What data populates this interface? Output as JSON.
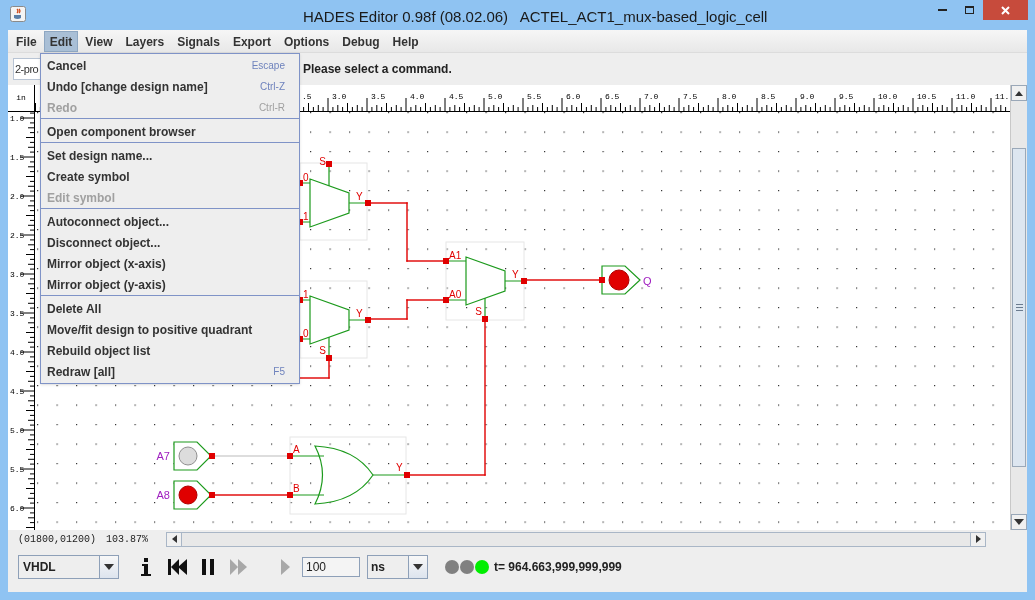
{
  "window": {
    "title": "HADES Editor 0.98f (08.02.06)   ACTEL_ACT1_mux-based_logic_cell"
  },
  "menu_bar": [
    {
      "label": "File",
      "selected": false
    },
    {
      "label": "Edit",
      "selected": true
    },
    {
      "label": "View",
      "selected": false
    },
    {
      "label": "Layers",
      "selected": false
    },
    {
      "label": "Signals",
      "selected": false
    },
    {
      "label": "Export",
      "selected": false
    },
    {
      "label": "Options",
      "selected": false
    },
    {
      "label": "Debug",
      "selected": false
    },
    {
      "label": "Help",
      "selected": false
    }
  ],
  "edit_menu": {
    "groups": [
      [
        {
          "label": "Cancel",
          "shortcut": "Escape",
          "disabled": false
        },
        {
          "label": "Undo [change design name]",
          "shortcut": "Ctrl-Z",
          "disabled": false
        },
        {
          "label": "Redo",
          "shortcut": "Ctrl-R",
          "disabled": true
        }
      ],
      [
        {
          "label": "Open component browser",
          "disabled": false
        }
      ],
      [
        {
          "label": "Set design name...",
          "disabled": false
        },
        {
          "label": "Create symbol",
          "disabled": false
        },
        {
          "label": "Edit symbol",
          "disabled": true
        }
      ],
      [
        {
          "label": "Autoconnect object...",
          "disabled": false
        },
        {
          "label": "Disconnect object...",
          "disabled": false
        },
        {
          "label": "Mirror object (x-axis)",
          "disabled": false
        },
        {
          "label": "Mirror object (y-axis)",
          "disabled": false
        }
      ],
      [
        {
          "label": "Delete All",
          "disabled": false
        },
        {
          "label": "Move/fit design to positive quadrant",
          "disabled": false
        },
        {
          "label": "Rebuild object list",
          "disabled": false
        },
        {
          "label": "Redraw [all]",
          "shortcut": "F5",
          "disabled": false
        }
      ]
    ]
  },
  "toolbar": {
    "design_combo": "2-pro",
    "status": "Please select a command."
  },
  "ruler": {
    "unit": "in",
    "top_labels": [
      ".5",
      "3.0",
      "3.5",
      "4.0",
      "4.5",
      "5.0",
      "5.5",
      "6.0",
      "6.5",
      "7.0",
      "7.5",
      "8.0",
      "8.5",
      "9.0",
      "9.5",
      "10.0",
      "10.5",
      "11.0",
      "11."
    ],
    "left_labels": [
      "1.0",
      "1.5",
      "2.0",
      "2.5",
      "3.0",
      "3.5",
      "4.0",
      "4.5",
      "5.0",
      "5.5",
      "6.0"
    ]
  },
  "schematic": {
    "components": [
      {
        "kind": "mux",
        "pins": [
          "0",
          "1",
          "S",
          "Y"
        ]
      },
      {
        "kind": "mux",
        "pins": [
          "1",
          "0",
          "S",
          "Y"
        ]
      },
      {
        "kind": "mux",
        "pins": [
          "A1",
          "A0",
          "S",
          "Y"
        ]
      },
      {
        "kind": "or",
        "pins": [
          "A",
          "B",
          "Y"
        ]
      },
      {
        "kind": "input",
        "name": "A7",
        "on": false
      },
      {
        "kind": "input",
        "name": "A8",
        "on": true
      },
      {
        "kind": "output",
        "name": "Q",
        "on": true
      }
    ],
    "wires": [
      {
        "active": true
      },
      {
        "active": true
      },
      {
        "active": true
      },
      {
        "active": true
      },
      {
        "active": false
      },
      {
        "active": true
      },
      {
        "active": true
      }
    ]
  },
  "status_bar": {
    "coordinates": "(01800,01200)",
    "zoom": "103.87%"
  },
  "simulator": {
    "language": "VHDL",
    "controls": [
      {
        "kind": "info",
        "disabled": false
      },
      {
        "kind": "rewind",
        "disabled": false
      },
      {
        "kind": "pause",
        "disabled": false
      },
      {
        "kind": "fast_forward",
        "disabled": true
      },
      {
        "kind": "play",
        "disabled": true
      }
    ],
    "step": "100",
    "unit": "ns",
    "indicators": [
      {
        "color": "#808080"
      },
      {
        "color": "#808080"
      },
      {
        "color": "#00ee00"
      }
    ],
    "time": "t= 964.663,999,999,999"
  }
}
